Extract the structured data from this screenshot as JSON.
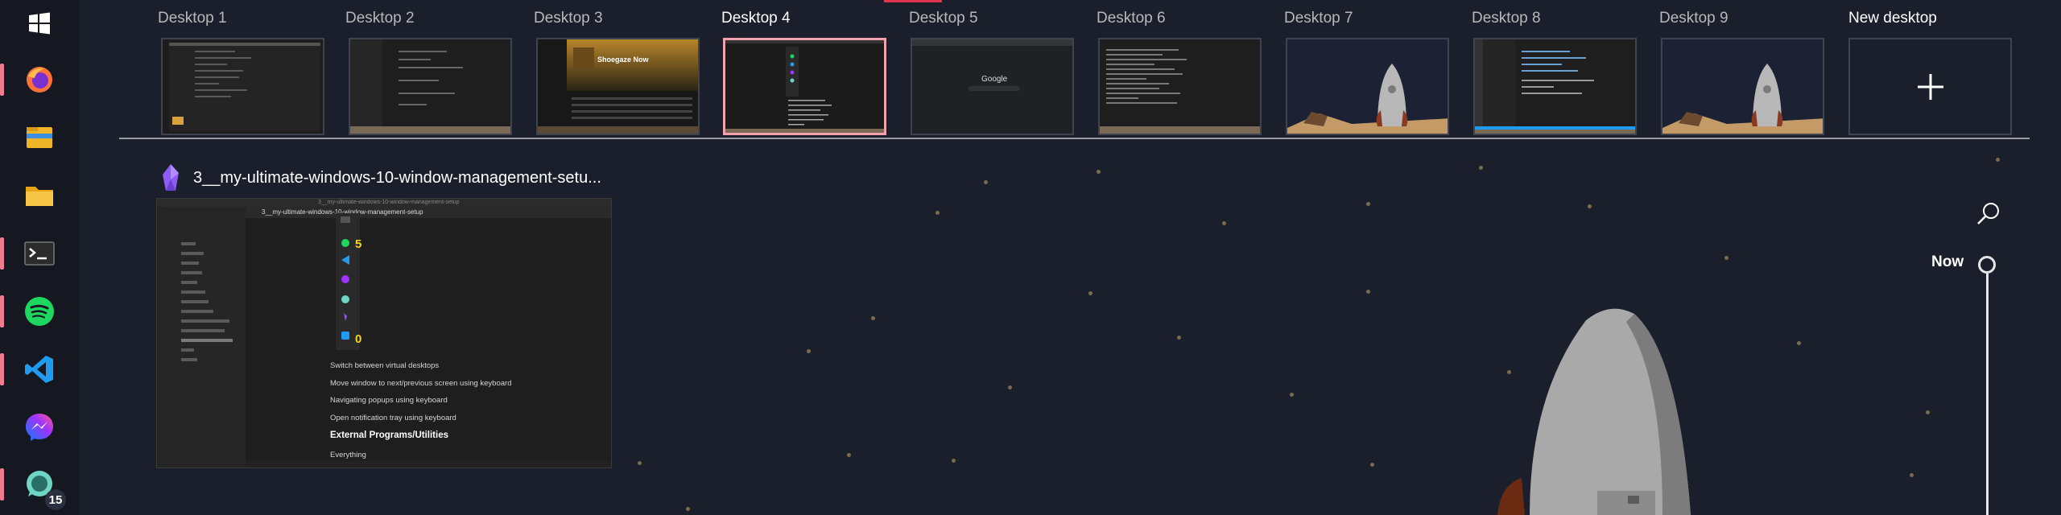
{
  "taskbar": {
    "items": [
      {
        "name": "windows-start",
        "running": false
      },
      {
        "name": "firefox",
        "running": true
      },
      {
        "name": "file-explorer",
        "running": false
      },
      {
        "name": "folder",
        "running": false
      },
      {
        "name": "terminal",
        "running": true
      },
      {
        "name": "spotify",
        "running": true
      },
      {
        "name": "vscode",
        "running": true
      },
      {
        "name": "messenger",
        "running": false
      },
      {
        "name": "whatsapp",
        "running": true,
        "badge": "15"
      }
    ],
    "accent": "#f07a8e"
  },
  "desktops": {
    "items": [
      {
        "label": "Desktop 1",
        "active": false
      },
      {
        "label": "Desktop 2",
        "active": false
      },
      {
        "label": "Desktop 3",
        "active": false,
        "thumb_text": "Shoegaze Now"
      },
      {
        "label": "Desktop 4",
        "active": true
      },
      {
        "label": "Desktop 5",
        "active": false,
        "thumb_text": "Google"
      },
      {
        "label": "Desktop 6",
        "active": false
      },
      {
        "label": "Desktop 7",
        "active": false
      },
      {
        "label": "Desktop 8",
        "active": false
      },
      {
        "label": "Desktop 9",
        "active": false
      }
    ],
    "new_label": "New desktop",
    "active_border": "#f4a1ae"
  },
  "window": {
    "title": "3__my-ultimate-windows-10-window-management-setu...",
    "thumb": {
      "tab_title": "3__my-ultimate-windows-10-window-management-setup",
      "badge_numbers": [
        "5",
        "0"
      ],
      "lines": [
        "Switch between virtual desktops",
        "Move window to next/previous screen using keyboard",
        "Navigating popups using keyboard",
        "Open notification tray using keyboard"
      ],
      "heading": "External Programs/Utilities",
      "last_line": "Everything"
    }
  },
  "timeline": {
    "now_label": "Now"
  },
  "colors": {
    "background": "#1b1f2c",
    "taskbar": "#151821",
    "accent_red": "#e0354f"
  }
}
